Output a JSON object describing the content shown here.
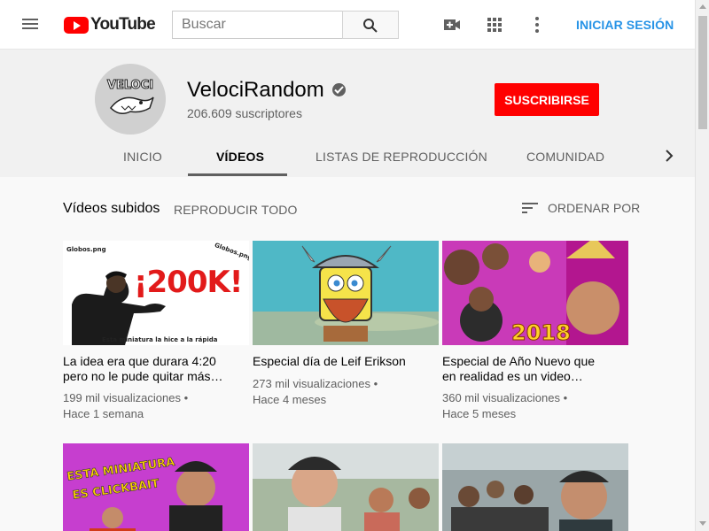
{
  "masthead": {
    "logo_text": "YouTube",
    "search_placeholder": "Buscar",
    "signin_label": "INICIAR SESIÓN"
  },
  "channel": {
    "name": "VelociRandom",
    "subscribers": "206.609 suscriptores",
    "subscribe_label": "SUSCRIBIRSE",
    "avatar_text": "VELOCI"
  },
  "tabs": [
    {
      "label": "INICIO"
    },
    {
      "label": "VÍDEOS"
    },
    {
      "label": "LISTAS DE REPRODUCCIÓN"
    },
    {
      "label": "COMUNIDAD"
    }
  ],
  "section": {
    "title": "Vídeos subidos",
    "play_all": "REPRODUCIR TODO",
    "sort_label": "ORDENAR POR"
  },
  "videos": [
    {
      "title_line1": "La idea era que durara 4:20",
      "title_line2": "pero no le pude quitar más…",
      "views": "199 mil visualizaciones",
      "age": "Hace 1 semana",
      "thumb_text": "¡200K!",
      "thumb_caption": "Esta miniatura la hice a la rápida",
      "thumb_corner_left": "Globos.png",
      "thumb_corner_right": "Globos.png"
    },
    {
      "title_line1": "Especial día de Leif Erikson",
      "title_line2": "",
      "views": "273 mil visualizaciones",
      "age": "Hace 4 meses"
    },
    {
      "title_line1": "Especial de Año Nuevo que",
      "title_line2": "en realidad es un video…",
      "views": "360 mil visualizaciones",
      "age": "Hace 5 meses",
      "thumb_text": "2018"
    },
    {
      "thumb_text_line1": "ESTA MINIATURA",
      "thumb_text_line2": "ES CLICKBAIT"
    },
    {},
    {}
  ],
  "colors": {
    "brand_red": "#ff0000",
    "signin_blue": "#2793e6"
  }
}
